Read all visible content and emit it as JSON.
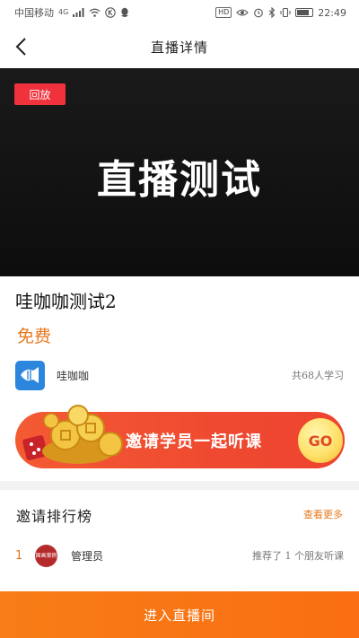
{
  "status_bar": {
    "carrier": "中国移动",
    "network": "4G",
    "hd_badge": "HD",
    "time": "22:49"
  },
  "nav": {
    "title": "直播详情"
  },
  "video": {
    "badge": "回放",
    "caption": "直播测试"
  },
  "course": {
    "title": "哇咖咖测试2",
    "price": "免费"
  },
  "teacher": {
    "name": "哇咖咖",
    "learner_count": "共68人学习"
  },
  "invite": {
    "text": "邀请学员一起听课",
    "go_label": "GO"
  },
  "ranking": {
    "title": "邀请排行榜",
    "see_more": "查看更多",
    "entries": [
      {
        "rank": "1",
        "avatar_text": "国画案例",
        "name": "管理员",
        "desc": "推荐了 1 个朋友听课"
      }
    ]
  },
  "footer": {
    "enter_label": "进入直播间"
  },
  "colors": {
    "accent_orange": "#f87d17",
    "replay_red": "#f0323c",
    "invite_red": "#ef4a31"
  }
}
